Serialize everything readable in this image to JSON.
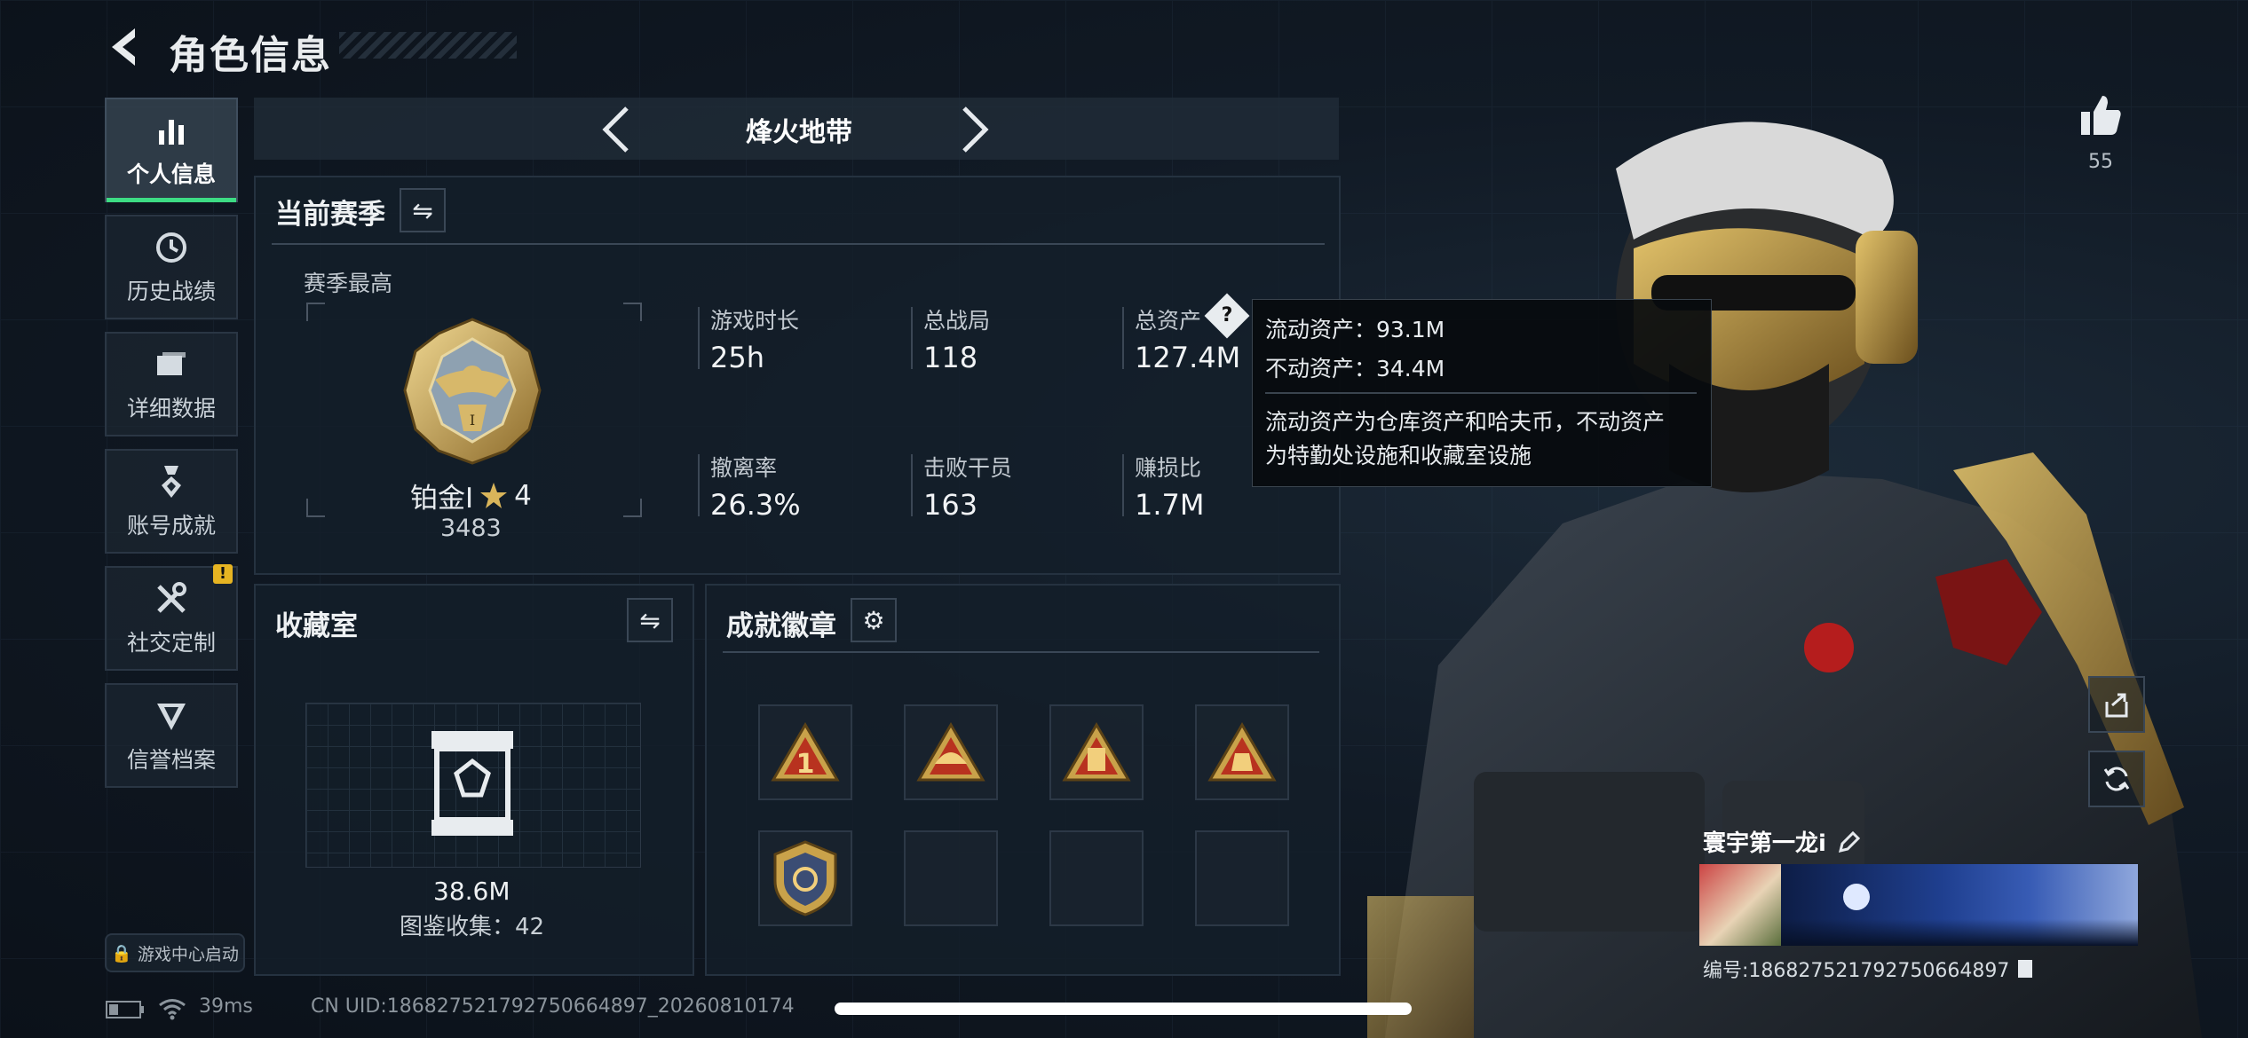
{
  "header": {
    "title": "角色信息"
  },
  "sidebar": {
    "items": [
      {
        "label": "个人信息",
        "icon": "bar-chart-icon",
        "active": true
      },
      {
        "label": "历史战绩",
        "icon": "clock-history-icon"
      },
      {
        "label": "详细数据",
        "icon": "folder-icon"
      },
      {
        "label": "账号成就",
        "icon": "medal-icon"
      },
      {
        "label": "社交定制",
        "icon": "tools-icon",
        "badge": "!"
      },
      {
        "label": "信誉档案",
        "icon": "shield-v-icon"
      }
    ],
    "launch_label": "游戏中心启动"
  },
  "mode": {
    "name": "烽火地带"
  },
  "season": {
    "title": "当前赛季",
    "best_label": "赛季最高",
    "rank_name": "铂金Ⅰ",
    "rank_stars": "4",
    "rank_score": "3483",
    "stats": [
      {
        "label": "游戏时长",
        "value": "25h"
      },
      {
        "label": "总战局",
        "value": "118"
      },
      {
        "label": "总资产",
        "value": "127.4M"
      },
      {
        "label": "撤离率",
        "value": "26.3%"
      },
      {
        "label": "击败干员",
        "value": "163"
      },
      {
        "label": "赚损比",
        "value": "1.7M"
      }
    ]
  },
  "tooltip": {
    "liquid": "流动资产：93.1M",
    "fixed": "不动资产：34.4M",
    "desc_line1": "流动资产为仓库资产和哈夫币，不动资产",
    "desc_line2": "为特勤处设施和收藏室设施"
  },
  "collection": {
    "title": "收藏室",
    "value": "38.6M",
    "count_label": "图鉴收集：42"
  },
  "achievements": {
    "title": "成就徽章",
    "slots_filled": 5,
    "slots_total": 8
  },
  "profile": {
    "likes": "55",
    "player_name": "寰宇第一龙i",
    "player_id": "编号:186827521792750664897"
  },
  "status": {
    "ping": "39ms",
    "uid": "CN UID:186827521792750664897_20260810174"
  },
  "colors": {
    "accent_green": "#3ddc84",
    "gold": "#c9a24a",
    "warning": "#e6b422"
  }
}
